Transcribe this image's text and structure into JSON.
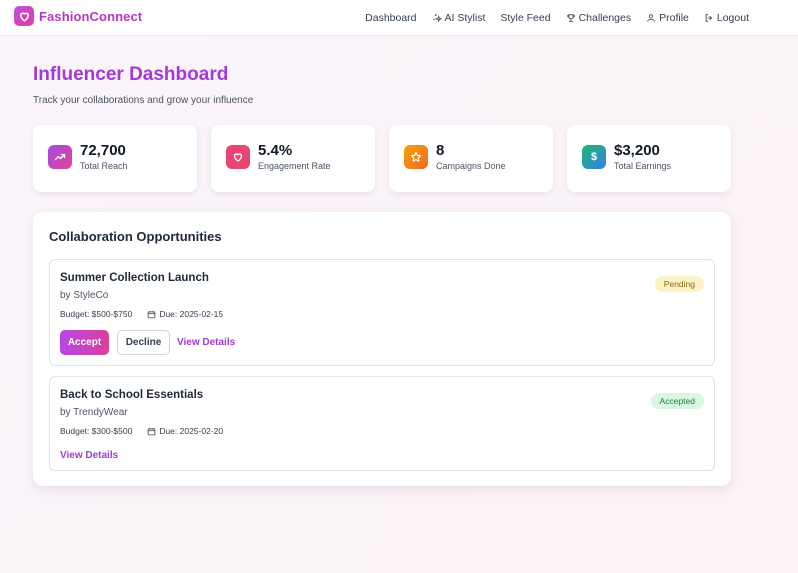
{
  "brand": {
    "name": "FashionConnect",
    "logo_icon": "heart-icon"
  },
  "nav": {
    "items": [
      {
        "label": "Dashboard",
        "icon": ""
      },
      {
        "label": "AI Stylist",
        "icon": "sparkles-icon"
      },
      {
        "label": "Style Feed",
        "icon": ""
      },
      {
        "label": "Challenges",
        "icon": "trophy-icon"
      },
      {
        "label": "Profile",
        "icon": "user-icon"
      },
      {
        "label": "Logout",
        "icon": "logout-icon"
      }
    ]
  },
  "header": {
    "title": "Influencer Dashboard",
    "subtitle": "Track your collaborations and grow your influence"
  },
  "stats": [
    {
      "value": "72,700",
      "label": "Total Reach",
      "icon": "trending-up-icon",
      "color_from": "#a34ae3",
      "color_to": "#e34398"
    },
    {
      "value": "5.4%",
      "label": "Engagement Rate",
      "icon": "heart-icon",
      "color_from": "#f0407a",
      "color_to": "#e34a6c"
    },
    {
      "value": "8",
      "label": "Campaigns Done",
      "icon": "star-icon",
      "color_from": "#f5a20c",
      "color_to": "#ef6a1f"
    },
    {
      "value": "$3,200",
      "label": "Total Earnings",
      "icon": "dollar-icon",
      "icon_text": "$",
      "color_from": "#22b673",
      "color_to": "#2f80e8"
    }
  ],
  "opportunities": {
    "title": "Collaboration Opportunities",
    "items": [
      {
        "title": "Summer Collection Launch",
        "brand": "by StyleCo",
        "budget": "Budget: $500-$750",
        "due": "Due: 2025-02-15",
        "status": "Pending",
        "accept_label": "Accept",
        "decline_label": "Decline",
        "details_label": "View Details"
      },
      {
        "title": "Back to School Essentials",
        "brand": "by TrendyWear",
        "budget": "Budget: $300-$500",
        "due": "Due: 2025-02-20",
        "status": "Accepted",
        "details_label": "View Details"
      }
    ]
  },
  "colors": {
    "accent": "#a23ad6",
    "pending_bg": "#fdf3c4",
    "accepted_bg": "#d9f6e1"
  }
}
